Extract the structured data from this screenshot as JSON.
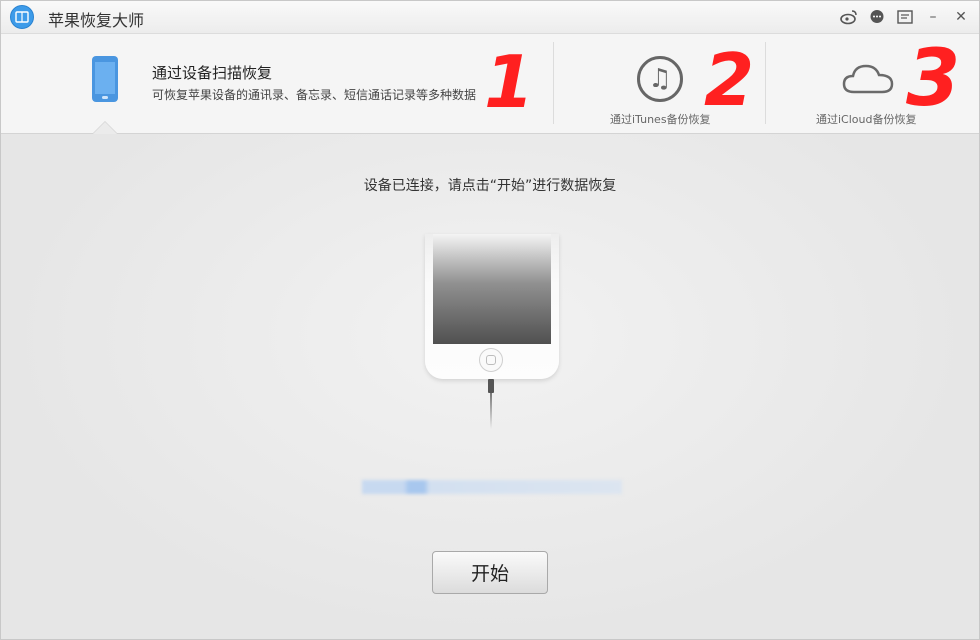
{
  "window": {
    "title": "苹果恢复大师",
    "titlebar_icons": [
      "weibo-icon",
      "chat-icon",
      "menu-icon",
      "minimize-icon",
      "close-icon"
    ],
    "minimize_glyph": "–",
    "close_glyph": "✕"
  },
  "tabs": [
    {
      "title": "通过设备扫描恢复",
      "desc": "可恢复苹果设备的通讯录、备忘录、短信通话记录等多种数据",
      "active": true,
      "icon": "phone-icon"
    },
    {
      "label": "通过iTunes备份恢复",
      "active": false,
      "icon": "itunes-music-icon",
      "glyph": "♫"
    },
    {
      "label": "通过iCloud备份恢复",
      "active": false,
      "icon": "cloud-icon"
    }
  ],
  "annotations": [
    "1",
    "2",
    "3"
  ],
  "main": {
    "instruction": "设备已连接，请点击“开始”进行数据恢复",
    "start_button": "开始"
  },
  "colors": {
    "accent": "#3d9be9",
    "annotation": "#ff2020"
  }
}
